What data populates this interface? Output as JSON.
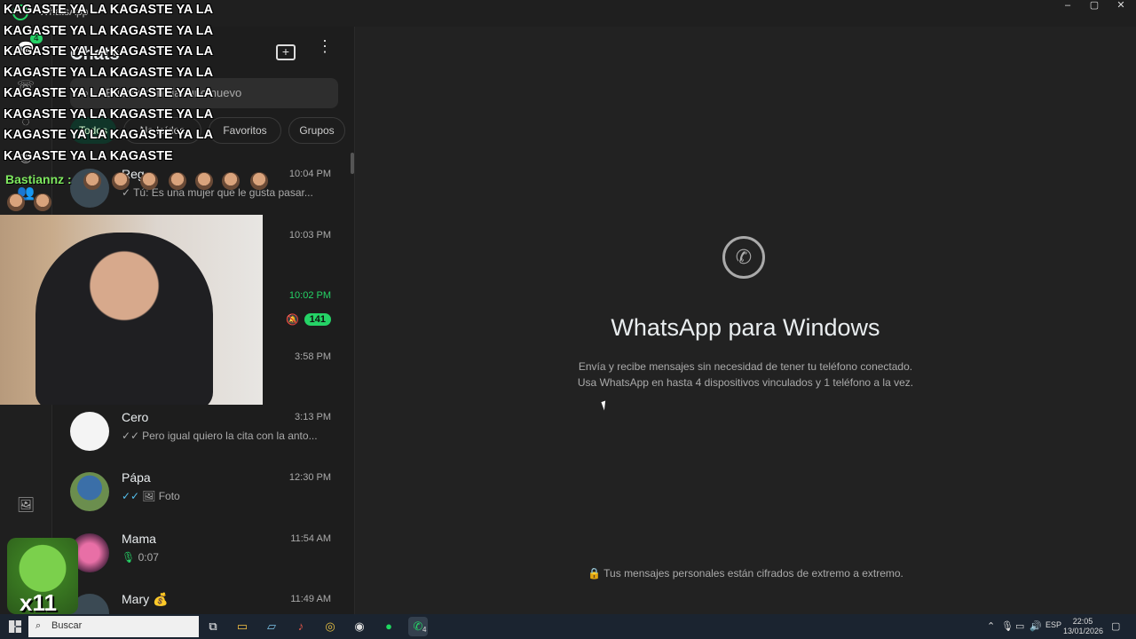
{
  "window": {
    "app_name": "WhatsApp",
    "controls": [
      "–",
      "▢",
      "✕"
    ]
  },
  "rail": {
    "badge": "4"
  },
  "panel": {
    "title": "Chats",
    "search_placeholder": "Buscar o iniciar uno nuevo",
    "filters": [
      "Todos",
      "No leídos",
      "Favoritos",
      "Grupos"
    ]
  },
  "chats": [
    {
      "name": "Reg",
      "time": "10:04 PM",
      "tick": "✓",
      "preview": "Tú: Es una mujer que le gusta pasar..."
    },
    {
      "name": "",
      "time": "10:03 PM",
      "preview": ""
    },
    {
      "name": "",
      "time": "10:02 PM",
      "unread": "141",
      "muted": true
    },
    {
      "name": "",
      "time": "3:58 PM",
      "preview": ""
    },
    {
      "name": "Cero",
      "time": "3:13 PM",
      "tick": "✓✓",
      "preview": "Pero igual quiero la cita con la anto..."
    },
    {
      "name": "Pápa",
      "time": "12:30 PM",
      "tick": "✓✓",
      "preview": "Foto"
    },
    {
      "name": "Mama",
      "time": "11:54 AM",
      "preview": "0:07"
    },
    {
      "name": "Mary 💰",
      "time": "11:49 AM",
      "preview": ""
    }
  ],
  "main": {
    "title": "WhatsApp para Windows",
    "desc_line1": "Envía y recibe mensajes sin necesidad de tener tu teléfono conectado.",
    "desc_line2": "Usa WhatsApp en hasta 4 dispositivos vinculados y 1 teléfono a la vez.",
    "encrypted": "Tus mensajes personales están cifrados de extremo a extremo."
  },
  "overlay": {
    "lines": [
      "KAGASTE YA LA KAGASTE YA LA",
      "KAGASTE YA LA KAGASTE YA LA",
      "KAGASTE YA LA KAGASTE YA LA",
      "KAGASTE YA LA KAGASTE YA LA",
      "KAGASTE YA LA KAGASTE YA LA",
      "KAGASTE YA LA KAGASTE YA LA",
      "KAGASTE YA LA KAGASTE YA LA",
      "KAGASTE YA LA KAGASTE"
    ],
    "user": "Bastiannz :",
    "goblin_label": "x11"
  },
  "taskbar": {
    "search": "Buscar",
    "whatsapp_badge": "4",
    "lang": "ESP",
    "time": "22:05",
    "date": "13/01/2026"
  },
  "colors": {
    "accent": "#25d366",
    "panel": "#1d1d1d",
    "main": "#222222"
  }
}
